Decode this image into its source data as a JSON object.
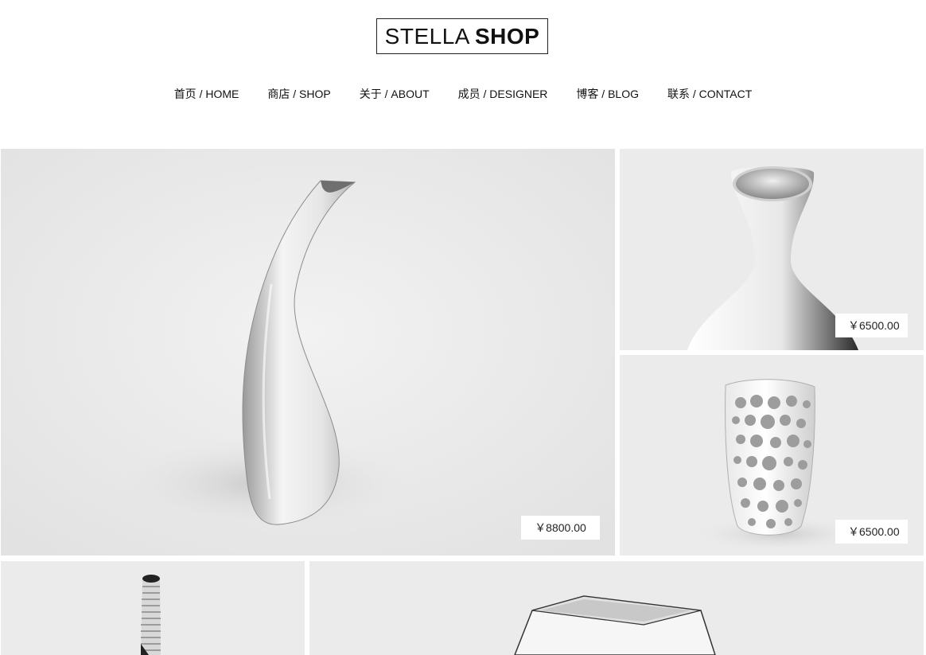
{
  "header": {
    "logo_light": "STELLA",
    "logo_bold": "SHOP"
  },
  "nav": {
    "items": [
      {
        "label": "首页 / HOME"
      },
      {
        "label": "商店 / SHOP"
      },
      {
        "label": "关于 / ABOUT"
      },
      {
        "label": "成员 / DESIGNER"
      },
      {
        "label": "博客 / BLOG"
      },
      {
        "label": "联系 / CONTACT"
      }
    ]
  },
  "products": [
    {
      "price": "￥8800.00"
    },
    {
      "price": "￥6500.00"
    },
    {
      "price": "￥6500.00"
    }
  ],
  "colors": {
    "tile_background": "#ebebeb",
    "price_tag_background": "#ffffff",
    "text": "#111111"
  }
}
